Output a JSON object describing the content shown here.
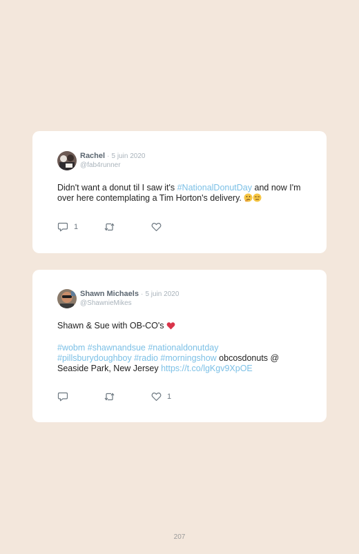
{
  "tweets": [
    {
      "name": "Rachel",
      "separator": "·",
      "date": "5 juin 2020",
      "handle": "@fab4runner",
      "text": {
        "t1": "Didn't want a donut til I saw it's ",
        "link1": "#NationalDonutDay",
        "t2": " and now I'm over here contemplating a Tim Horton's delivery. ",
        "emoji1": "thinking-face",
        "emoji2": "expressionless-face"
      },
      "reply_count": "1",
      "retweet_count": "",
      "like_count": ""
    },
    {
      "name": "Shawn Michaels",
      "separator": "·",
      "date": "5 juin 2020",
      "handle": "@ShawnieMikes",
      "text": {
        "line1": "Shawn & Sue with OB-CO's ",
        "emoji1": "red-heart",
        "tags1": "#wobm #shawnandsue #nationaldonutday",
        "tags2": "#pillsburydoughboy #radio #morningshow",
        "t3": " obcosdonuts @ Seaside Park, New Jersey ",
        "url": "https://t.co/lgKgv9XpOE"
      },
      "reply_count": "",
      "retweet_count": "",
      "like_count": "1"
    }
  ],
  "page_number": "207",
  "colors": {
    "background": "#f3e7dc",
    "card": "#ffffff",
    "link": "#7cc0e6",
    "name": "#5b6670",
    "muted": "#a9b3bb",
    "heart": "#d9344a"
  },
  "icons": [
    "reply-icon",
    "retweet-icon",
    "like-icon"
  ]
}
